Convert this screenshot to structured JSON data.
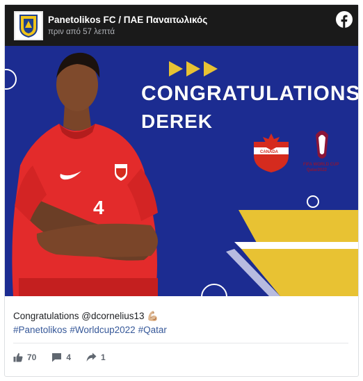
{
  "post": {
    "page_name": "Panetolikos FC / ΠΑΕ Παναιτωλικός",
    "time": "πριν από 57 λεπτά",
    "image": {
      "headline_line1": "CONGRATULATIONS",
      "headline_line2": "DEREK",
      "jersey_number": "4",
      "crest_text": "CANADA",
      "wc_text": "FIFA WORLD CUP",
      "wc_sub": "Qatar2022"
    },
    "caption": "Congratulations @dcornelius13 💪🏼",
    "hashtags": [
      "#Panetolikos",
      "#Worldcup2022",
      "#Qatar"
    ],
    "stats": {
      "likes": "70",
      "comments": "4",
      "shares": "1"
    }
  },
  "colors": {
    "header_bg": "#1a1a1a",
    "image_bg": "#1c2c91",
    "gold": "#e8c233",
    "canada_red": "#d52b1e",
    "link": "#365899",
    "fb_blue": "#1877f2"
  },
  "icons": {
    "like": "thumbs-up-icon",
    "comment": "comment-icon",
    "share": "share-icon",
    "brand": "facebook-icon"
  }
}
